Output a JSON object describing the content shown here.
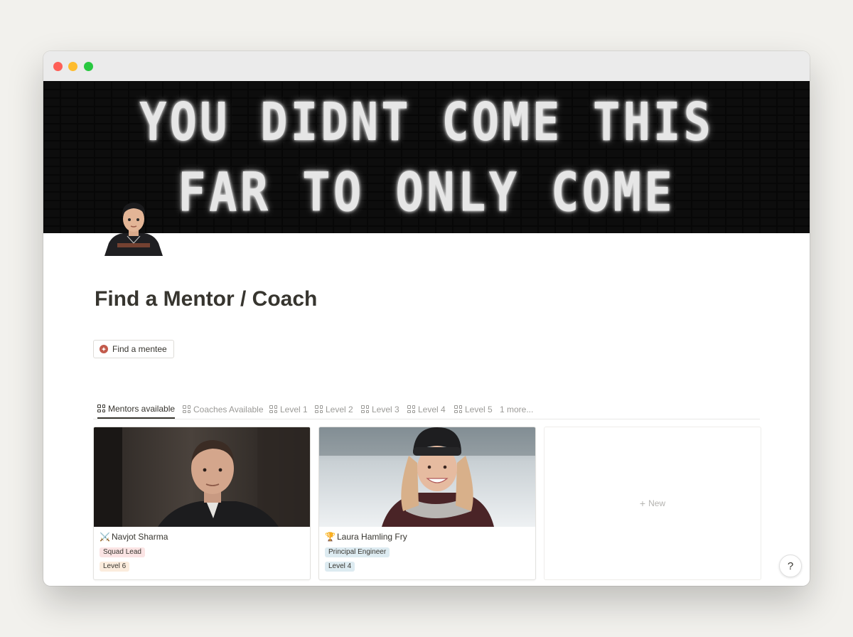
{
  "cover": {
    "line1": "YOU DIDNT COME THIS",
    "line2": "FAR TO ONLY COME"
  },
  "page": {
    "title": "Find a Mentor / Coach"
  },
  "link_button": {
    "label": "Find a mentee"
  },
  "tabs": [
    {
      "label": "Mentors available",
      "active": true
    },
    {
      "label": "Coaches Available"
    },
    {
      "label": "Level 1"
    },
    {
      "label": "Level 2"
    },
    {
      "label": "Level 3"
    },
    {
      "label": "Level 4"
    },
    {
      "label": "Level 5"
    },
    {
      "label": "1 more..."
    }
  ],
  "cards": [
    {
      "emoji": "⚔️",
      "name": "Navjot Sharma",
      "tags": [
        {
          "label": "Squad Lead",
          "color": "#fbe4e4"
        },
        {
          "label": "Level 6",
          "color": "#fbecdd"
        }
      ]
    },
    {
      "emoji": "🏆",
      "name": "Laura Hamling Fry",
      "tags": [
        {
          "label": "Principal Engineer",
          "color": "#ddebf1"
        },
        {
          "label": "Level 4",
          "color": "#ddebf1"
        }
      ]
    }
  ],
  "new_card": {
    "label": "New"
  },
  "help": {
    "label": "?"
  }
}
